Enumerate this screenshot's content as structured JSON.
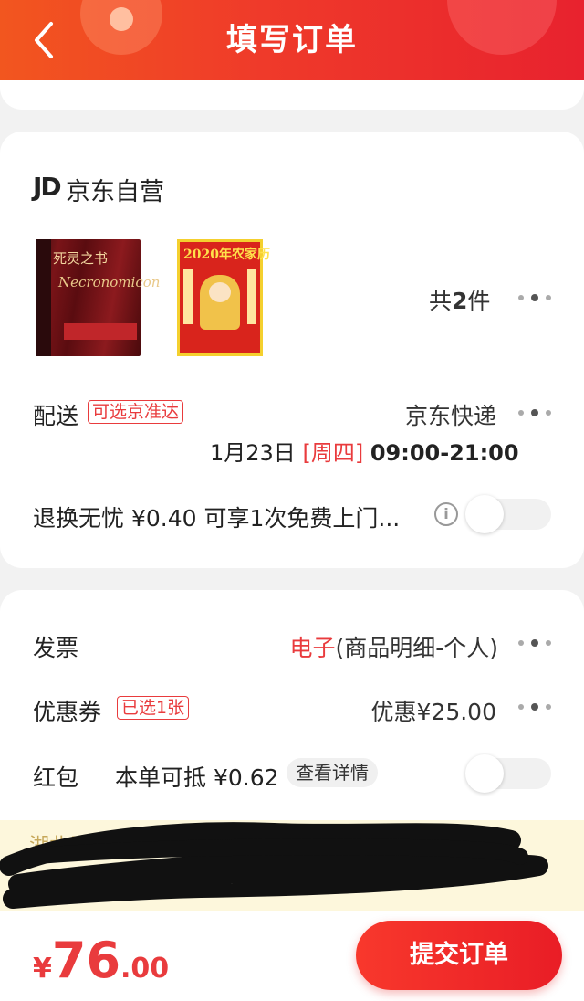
{
  "header": {
    "title": "填写订单",
    "back_icon": "chevron-left-icon"
  },
  "shop": {
    "logo": "JD",
    "name": "京东自营",
    "product_images": [
      "book-necronomicon-image",
      "almanac-2020-image"
    ],
    "book1_cover_title": "死灵之书",
    "book1_cover_subtitle": "Necronomicon",
    "book2_cover_title": "2020年农家历",
    "count_prefix": "共",
    "count_number": "2",
    "count_suffix": "件"
  },
  "delivery": {
    "label": "配送",
    "tag": "可选京准达",
    "carrier": "京东快递",
    "date": "1月23日",
    "weekday": "[周四]",
    "time": "09:00-21:00"
  },
  "return_service": {
    "label": "退换无忧 ¥0.40 可享1次免费上门...",
    "info_icon": "info-icon",
    "enabled": false
  },
  "invoice": {
    "label": "发票",
    "type": "电子",
    "detail": "(商品明细-个人)"
  },
  "coupon": {
    "label": "优惠券",
    "tag": "已选1张",
    "discount": "优惠¥25.00"
  },
  "red_packet": {
    "label": "红包",
    "deduct": "本单可抵 ¥0.62",
    "detail_button": "查看详情",
    "enabled": false
  },
  "address": {
    "text": "湖北武汉市江夏区城区西交路 22号（Ш…对面）"
  },
  "footer": {
    "currency": "¥",
    "price_int": "76",
    "price_dec": ".00",
    "submit_label": "提交订单"
  },
  "colors": {
    "accent": "#e93b3d",
    "header_start": "#f2561f",
    "header_end": "#e8222e",
    "address_bg": "#fdf7dc"
  }
}
